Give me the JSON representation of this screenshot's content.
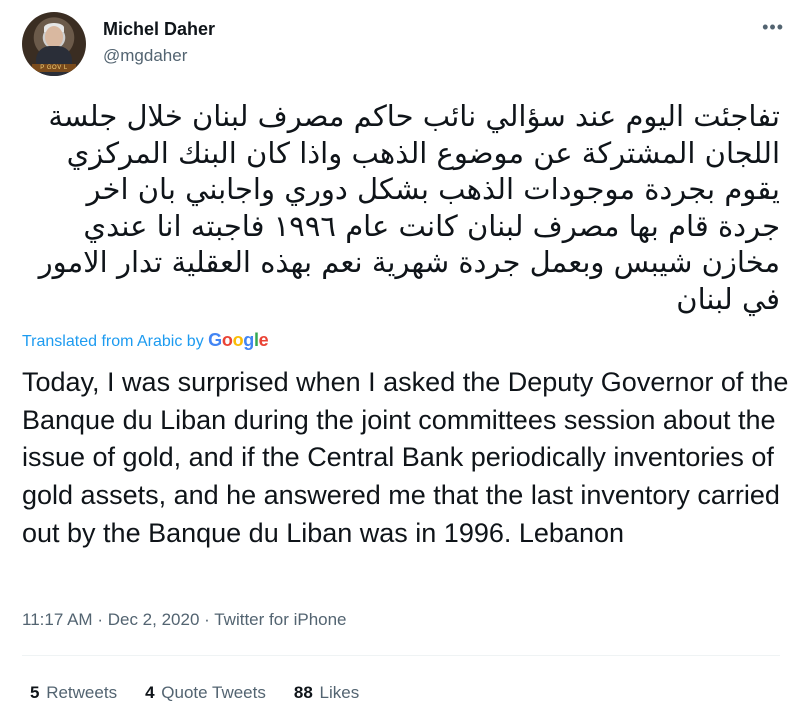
{
  "author": {
    "name": "Michel Daher",
    "handle": "@mgdaher",
    "avatar_plate_text": "P GOV L"
  },
  "more_label": "•••",
  "tweet": {
    "arabic_text": "تفاجئت اليوم عند سؤالي نائب حاكم مصرف لبنان خلال جلسة اللجان المشتركة عن موضوع الذهب واذا كان البنك المركزي يقوم بجردة موجودات الذهب بشكل دوري واجابني بان اخر جردة قام بها  مصرف لبنان كانت عام ١٩٩٦ فاجبته انا عندي مخازن شيبس وبعمل جردة شهرية نعم بهذه العقلية تدار الامور في لبنان",
    "translated_label": "Translated from Arabic by",
    "google_letters": [
      "G",
      "o",
      "o",
      "g",
      "l",
      "e"
    ],
    "english_text": "Today, I was surprised when I asked the Deputy Governor of the Banque du Liban during the joint committees session about the issue of gold, and if the Central Bank periodically inventories of gold assets, and he answered me that the last inventory carried out by the Banque du Liban was in 1996. Lebanon"
  },
  "meta": {
    "time": "11:17 AM",
    "separator": "·",
    "date": "Dec 2, 2020",
    "source": "Twitter for iPhone"
  },
  "stats": {
    "retweets_count": "5",
    "retweets_label": "Retweets",
    "quote_tweets_count": "4",
    "quote_tweets_label": "Quote Tweets",
    "likes_count": "88",
    "likes_label": "Likes"
  },
  "colors": {
    "link_blue": "#1d9bf0",
    "secondary_text": "#536471",
    "primary_text": "#0f1419"
  }
}
